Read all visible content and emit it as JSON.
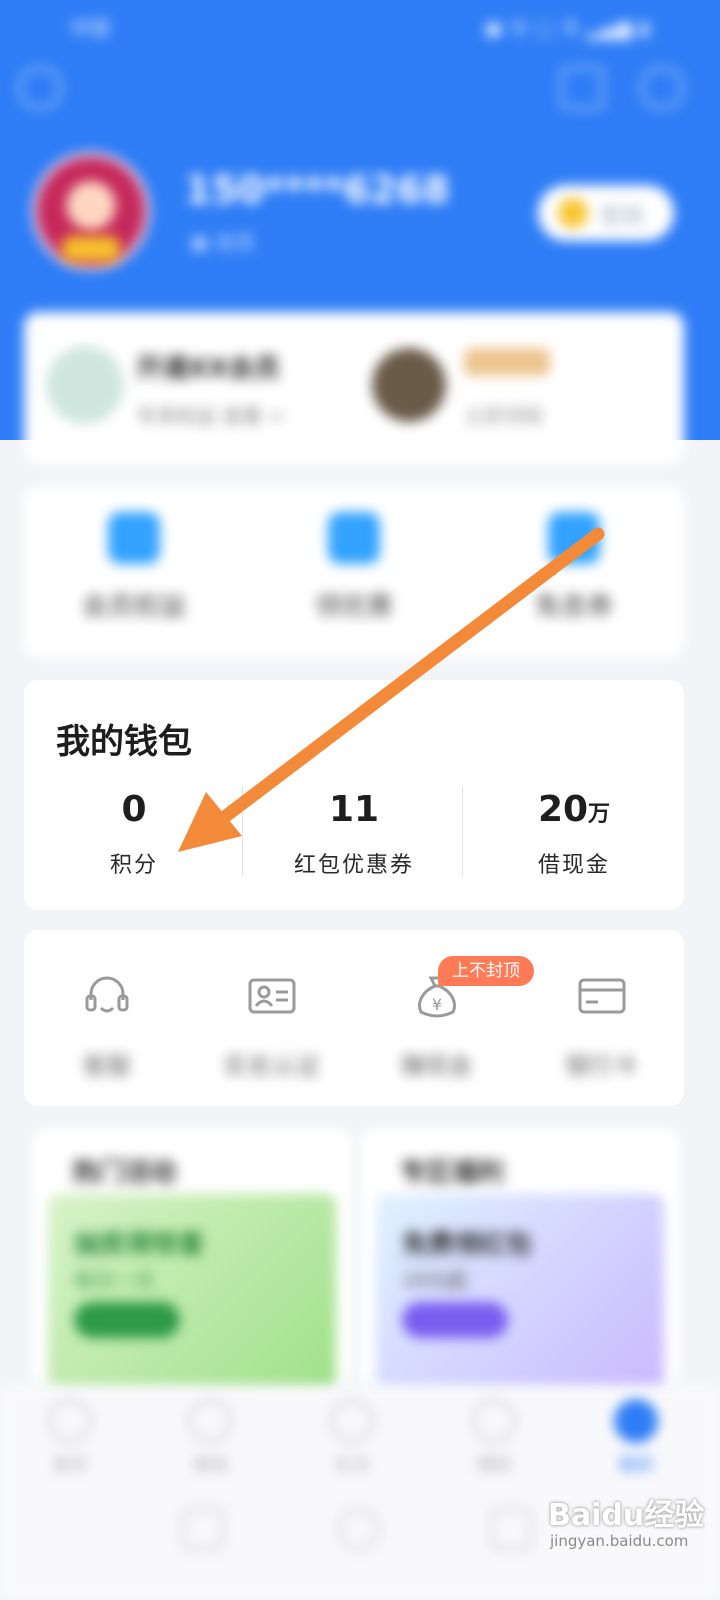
{
  "status_bar": {
    "time": "中国",
    "icons": "● 令  □  令 ▂▄▆ ▮"
  },
  "header": {
    "username": "150****6268",
    "user_sub": "▣ 会员",
    "pill_label": "签到"
  },
  "vip": {
    "title": "开通XX会员",
    "subtitle": "专享权益 查看 >",
    "badge": "",
    "caption": "立即领取"
  },
  "services": [
    {
      "label": "会员权益"
    },
    {
      "label": "领优惠"
    },
    {
      "label": "免息券"
    }
  ],
  "wallet": {
    "title": "我的钱包",
    "items": [
      {
        "value": "0",
        "unit": "",
        "label": "积分"
      },
      {
        "value": "11",
        "unit": "",
        "label": "红包优惠券"
      },
      {
        "value": "20",
        "unit": "万",
        "label": "借现金"
      }
    ]
  },
  "tools": {
    "promo_tag": "上不封顶",
    "items": [
      {
        "label": "客服",
        "icon": "headset-icon"
      },
      {
        "label": "实名认证",
        "icon": "id-card-icon"
      },
      {
        "label": "赚现金",
        "icon": "money-bag-icon"
      },
      {
        "label": "银行卡",
        "icon": "bank-card-icon"
      }
    ]
  },
  "promos": [
    {
      "title": "热门活动",
      "line1": "抽奖得惊喜",
      "line2": "每日一次",
      "color": "#2d9a48"
    },
    {
      "title": "专区福利",
      "line1": "免费领红包",
      "line2": "10元起",
      "color": "#7a5ef0"
    }
  ],
  "tabbar": {
    "tabs": [
      {
        "label": "首页"
      },
      {
        "label": "借钱"
      },
      {
        "label": "生活"
      },
      {
        "label": "理财"
      },
      {
        "label": "我的"
      }
    ]
  },
  "annotation": {
    "arrow_color": "#f28a3a"
  },
  "watermark": {
    "text": "Baidu经验",
    "sub": "jingyan.baidu.com"
  }
}
